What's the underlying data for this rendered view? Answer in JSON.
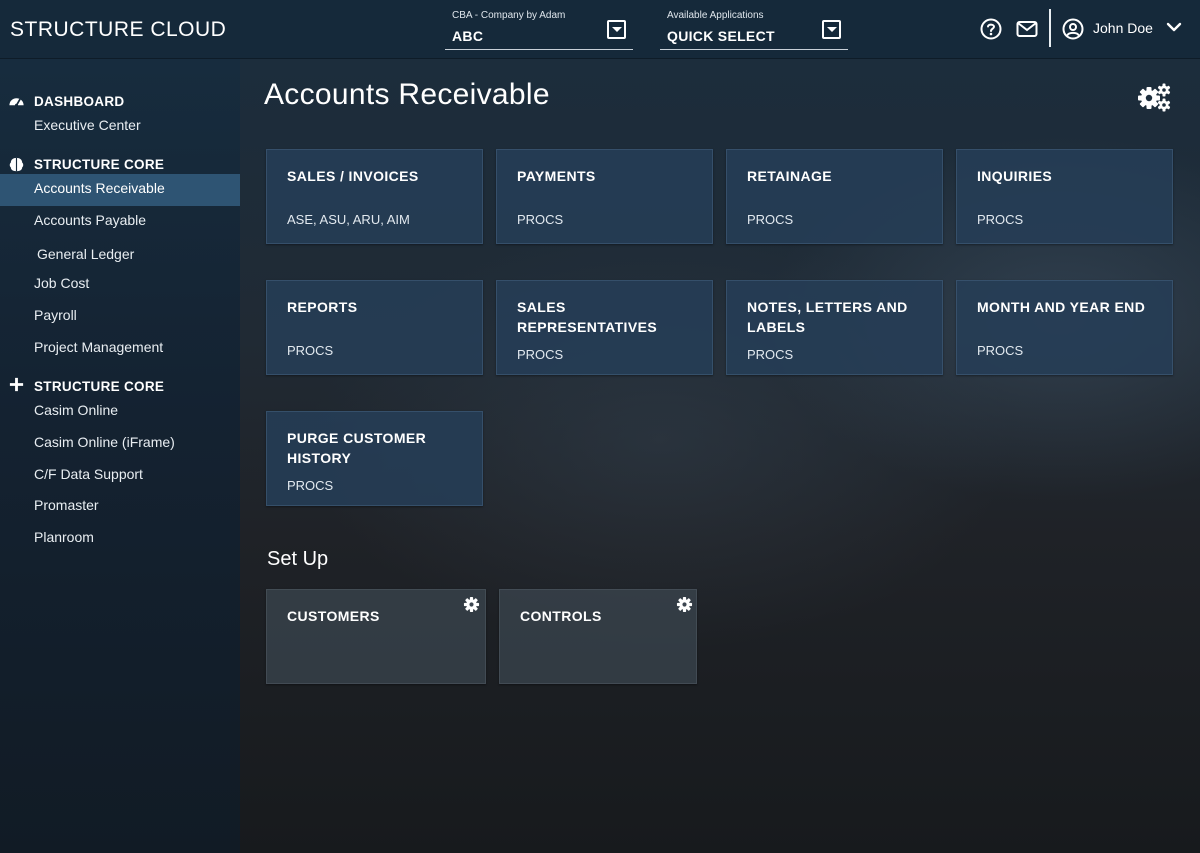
{
  "header": {
    "app_title": "STRUCTURE CLOUD",
    "company_selector": {
      "label": "CBA - Company by Adam",
      "value": "ABC"
    },
    "app_selector": {
      "label": "Available Applications",
      "value": "QUICK SELECT"
    },
    "icons": [
      "help-icon",
      "mail-icon",
      "user-icon",
      "chevron-down-icon"
    ],
    "user_name": "John Doe"
  },
  "sidebar": {
    "sections": [
      {
        "title": "DASHBOARD",
        "icon": "dashboard-icon",
        "items": [
          "Executive Center"
        ]
      },
      {
        "title": "STRUCTURE CORE",
        "icon": "brain-icon",
        "items": [
          "Accounts Receivable",
          "Accounts Payable",
          "General Ledger",
          "Job Cost",
          "Payroll",
          "Project Management"
        ]
      },
      {
        "title": "STRUCTURE CORE",
        "icon": "plus-icon",
        "items": [
          "Casim Online",
          "Casim Online (iFrame)",
          "C/F Data Support",
          "Promaster",
          "Planroom"
        ]
      }
    ],
    "active_item": "Accounts Receivable",
    "active_color": "#2e5473"
  },
  "main": {
    "title": "Accounts Receivable",
    "tiles": [
      {
        "title": "SALES / INVOICES",
        "sub": "ASE, ASU, ARU, AIM"
      },
      {
        "title": "PAYMENTS",
        "sub": "PROCS"
      },
      {
        "title": "RETAINAGE",
        "sub": "PROCS"
      },
      {
        "title": "INQUIRIES",
        "sub": "PROCS"
      },
      {
        "title": "REPORTS",
        "sub": "PROCS"
      },
      {
        "title": "SALES REPRESENTATIVES",
        "sub": "PROCS"
      },
      {
        "title": "NOTES, LETTERS AND LABELS",
        "sub": "PROCS"
      },
      {
        "title": "MONTH AND YEAR END",
        "sub": "PROCS"
      },
      {
        "title": "PURGE CUSTOMER HISTORY",
        "sub": "PROCS"
      }
    ],
    "setup": {
      "title": "Set Up",
      "tiles": [
        {
          "title": "CUSTOMERS"
        },
        {
          "title": "CONTROLS"
        }
      ]
    }
  }
}
